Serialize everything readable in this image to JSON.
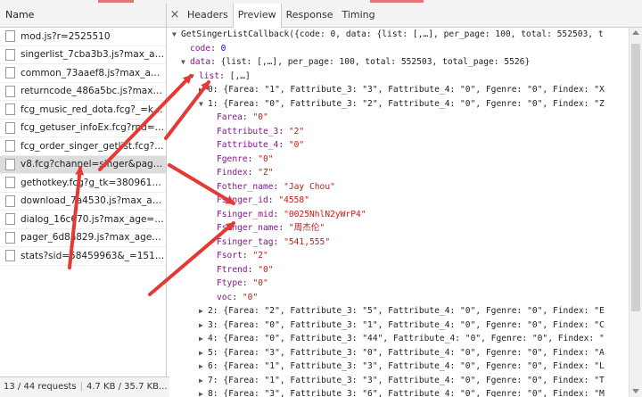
{
  "colors": {
    "annotation_arrow": "#e53935",
    "key": "#881391",
    "string": "#c41a16",
    "number": "#1c00cf"
  },
  "left_panel": {
    "header": "Name",
    "requests": [
      "mod.js?r=2525510",
      "singerlist_7cba3b3.js?max_age...",
      "common_73aaef8.js?max_age...",
      "returncode_486a5bc.js?max_a...",
      "fcg_music_red_dota.fcg?_=k=...",
      "fcg_getuser_infoEx.fcg?rnd=25...",
      "fcg_order_singer_getlist.fcg?ut...",
      "v8.fcg?channel=singer&page=...",
      "gethotkey.fcg?g_tk=38096105...",
      "download_7a4530.js?max_ag...",
      "dialog_16c670.js?max_age=3...",
      "pager_6d8a829.js?max_age=3...",
      "stats?sid=58459963&_=15153..."
    ],
    "selected_index": 7,
    "footer": {
      "requests": "13 / 44 requests",
      "size": "4.7 KB / 35.7 KB..."
    }
  },
  "right_panel": {
    "tabs": [
      "Headers",
      "Preview",
      "Response",
      "Timing"
    ],
    "active_tab": "Preview",
    "close_glyph": "×",
    "preview": {
      "root": "GetSingerListCallback({code: 0, data: {list: [,…], per_page: 100, total: 552503, t",
      "code_key": "code",
      "code_val": "0",
      "data_key": "data",
      "data_summary": "{list: [,…], per_page: 100, total: 552503, total_page: 5526}",
      "list_key": "list",
      "list_summary": "[,…]",
      "item0": "0: {Farea: \"1\", Fattribute_3: \"3\", Fattribute_4: \"0\", Fgenre: \"0\", Findex: \"X",
      "item1": "1: {Farea: \"0\", Fattribute_3: \"2\", Fattribute_4: \"0\", Fgenre: \"0\", Findex: \"Z",
      "fields": [
        {
          "k": "Farea",
          "v": "\"0\""
        },
        {
          "k": "Fattribute_3",
          "v": "\"2\""
        },
        {
          "k": "Fattribute_4",
          "v": "\"0\""
        },
        {
          "k": "Fgenre",
          "v": "\"0\""
        },
        {
          "k": "Findex",
          "v": "\"Z\""
        },
        {
          "k": "Fother_name",
          "v": "\"Jay Chou\""
        },
        {
          "k": "Fsinger_id",
          "v": "\"4558\""
        },
        {
          "k": "Fsinger_mid",
          "v": "\"0025NhlN2yWrP4\""
        },
        {
          "k": "Fsinger_name",
          "v": "\"周杰伦\""
        },
        {
          "k": "Fsinger_tag",
          "v": "\"541,555\""
        },
        {
          "k": "Fsort",
          "v": "\"2\""
        },
        {
          "k": "Ftrend",
          "v": "\"0\""
        },
        {
          "k": "Ftype",
          "v": "\"0\""
        },
        {
          "k": "voc",
          "v": "\"0\""
        }
      ],
      "items_rest": [
        "2: {Farea: \"2\", Fattribute_3: \"5\", Fattribute_4: \"0\", Fgenre: \"0\", Findex: \"E",
        "3: {Farea: \"0\", Fattribute_3: \"1\", Fattribute_4: \"0\", Fgenre: \"0\", Findex: \"C",
        "4: {Farea: \"0\", Fattribute_3: \"44\", Fattribute_4: \"0\", Fgenre: \"0\", Findex: \"",
        "5: {Farea: \"3\", Fattribute_3: \"0\", Fattribute_4: \"0\", Fgenre: \"0\", Findex: \"A",
        "6: {Farea: \"1\", Fattribute_3: \"3\", Fattribute_4: \"0\", Fgenre: \"0\", Findex: \"L",
        "7: {Farea: \"1\", Fattribute_3: \"3\", Fattribute_4: \"0\", Fgenre: \"0\", Findex: \"T",
        "8: {Farea: \"3\", Fattribute_3: \"6\", Fattribute_4: \"0\", Fgenre: \"0\", Findex: \"M"
      ]
    }
  }
}
